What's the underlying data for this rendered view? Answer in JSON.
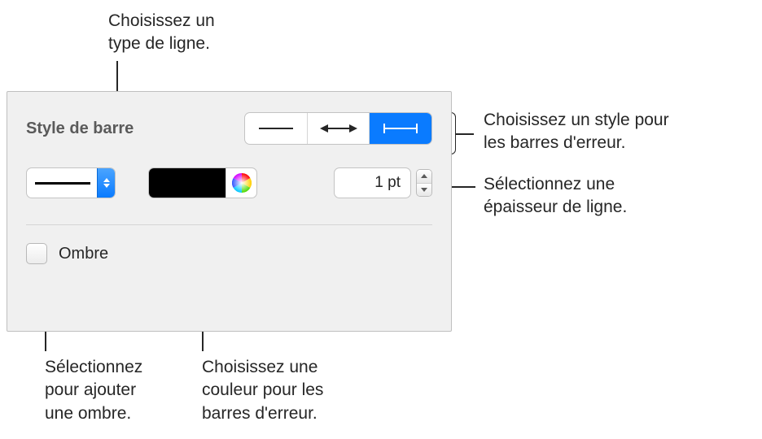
{
  "callouts": {
    "line_type": "Choisissez un\ntype de ligne.",
    "bar_style": "Choisissez un style pour\nles barres d'erreur.",
    "thickness": "Sélectionnez une\népaisseur de ligne.",
    "shadow": "Sélectionnez\npour ajouter\nune ombre.",
    "color": "Choisissez une\ncouleur pour les\nbarres d'erreur."
  },
  "panel": {
    "section_label": "Style de barre",
    "thickness_value": "1 pt",
    "shadow_label": "Ombre"
  }
}
